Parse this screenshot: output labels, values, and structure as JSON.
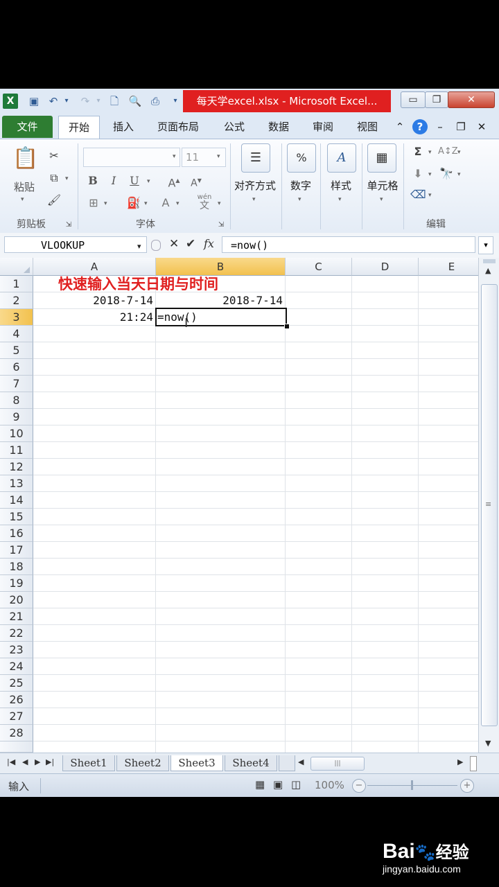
{
  "titlebar": {
    "doc_title": "每天学excel.xlsx - Microsoft Excel...",
    "app_icon": "X",
    "minimize": "▭",
    "restore": "❐",
    "close": "✕"
  },
  "tabs": [
    {
      "label": "文件"
    },
    {
      "label": "开始"
    },
    {
      "label": "插入"
    },
    {
      "label": "页面布局"
    },
    {
      "label": "公式"
    },
    {
      "label": "数据"
    },
    {
      "label": "审阅"
    },
    {
      "label": "视图"
    }
  ],
  "ribbon": {
    "paste_label": "粘贴",
    "clipboard_group": "剪贴板",
    "font_size": "11",
    "font_group": "字体",
    "align_label": "对齐方式",
    "number_label": "数字",
    "style_label": "样式",
    "cells_label": "单元格",
    "edit_group": "编辑",
    "bold": "B",
    "italic": "I",
    "underline": "U",
    "percent": "%",
    "sigma": "Σ",
    "wen": "wén"
  },
  "formula_bar": {
    "name_box": "VLOOKUP",
    "formula": "=now()",
    "fx": "fx"
  },
  "columns": [
    "A",
    "B",
    "C",
    "D",
    "E"
  ],
  "rows": [
    "1",
    "2",
    "3",
    "4",
    "5",
    "6",
    "7",
    "8",
    "9",
    "10",
    "11",
    "12",
    "13",
    "14",
    "15",
    "16",
    "17",
    "18",
    "19",
    "20",
    "21",
    "22",
    "23",
    "24",
    "25",
    "26",
    "27",
    "28"
  ],
  "cells": {
    "A1": "快速输入当天日期与时间",
    "A2": "2018-7-14",
    "B2": "2018-7-14",
    "A3": "21:24",
    "B3": "=now()"
  },
  "sheets": [
    "Sheet1",
    "Sheet2",
    "Sheet3",
    "Sheet4"
  ],
  "active_sheet": "Sheet3",
  "status": {
    "mode": "输入",
    "zoom": "100%"
  },
  "watermark": {
    "brand": "Bai",
    "brand_cn": "经验",
    "url": "jingyan.baidu.com"
  },
  "colors": {
    "title_red": "#e02020",
    "file_tab_green": "#2e7d32",
    "header_cell_red": "#e02020",
    "active_header": "#f2c14e"
  }
}
